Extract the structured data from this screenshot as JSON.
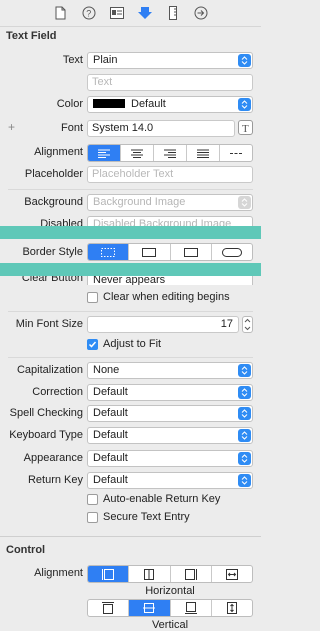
{
  "toolbar": {
    "icons": [
      "file-icon",
      "help-icon",
      "identity-icon",
      "attributes-icon",
      "size-icon",
      "connections-icon"
    ]
  },
  "textfield": {
    "title": "Text Field",
    "text_label": "Text",
    "text_value": "Plain",
    "text_placeholder": "Text",
    "color_label": "Color",
    "color_value": "Default",
    "color_swatch": "#000000",
    "font_label": "Font",
    "font_value": "System 14.0",
    "font_plus": "+",
    "alignment_label": "Alignment",
    "placeholder_label": "Placeholder",
    "placeholder_hint": "Placeholder Text",
    "background_label": "Background",
    "background_hint": "Background Image",
    "disabled_label": "Disabled",
    "disabled_hint": "Disabled Background Image",
    "border_label": "Border Style",
    "clear_label": "Clear Button",
    "clear_value": "Never appears",
    "clear_editing_label": "Clear when editing begins",
    "min_font_label": "Min Font Size",
    "min_font_value": "17",
    "adjust_label": "Adjust to Fit",
    "cap_label": "Capitalization",
    "cap_value": "None",
    "correction_label": "Correction",
    "correction_value": "Default",
    "spell_label": "Spell Checking",
    "spell_value": "Default",
    "keyboard_label": "Keyboard Type",
    "keyboard_value": "Default",
    "appearance_label": "Appearance",
    "appearance_value": "Default",
    "return_label": "Return Key",
    "return_value": "Default",
    "auto_enable_label": "Auto-enable Return Key",
    "secure_label": "Secure Text Entry"
  },
  "control": {
    "title": "Control",
    "alignment_label": "Alignment",
    "horizontal_caption": "Horizontal",
    "vertical_caption": "Vertical"
  },
  "colors": {
    "accent": "#2f7ff3",
    "teal_band": "#5fc8b8"
  }
}
